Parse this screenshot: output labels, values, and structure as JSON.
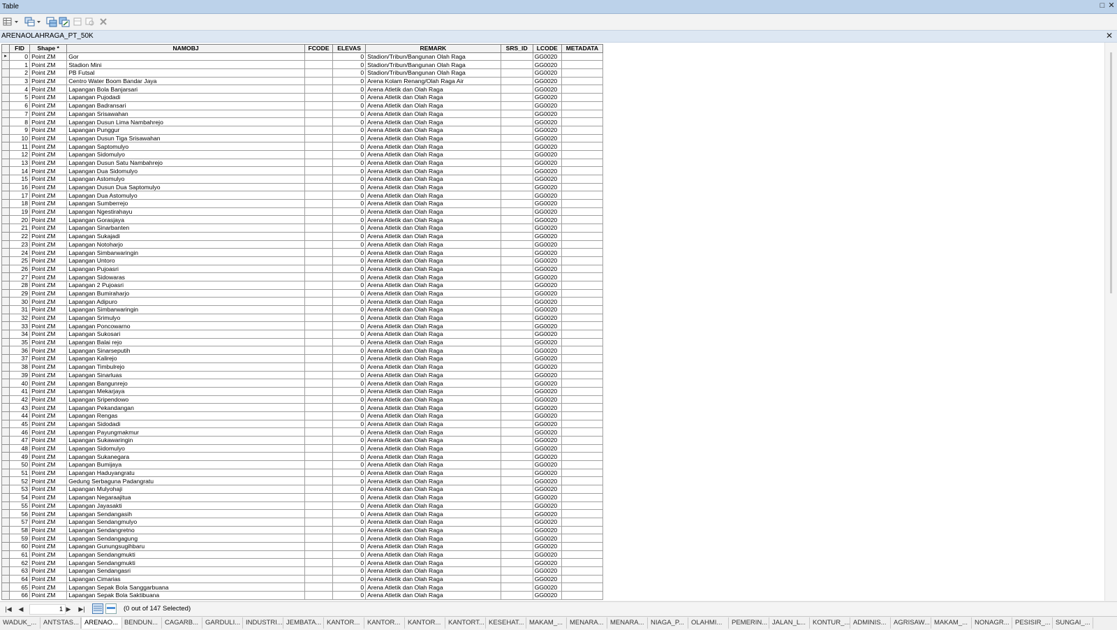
{
  "window": {
    "title": "Table"
  },
  "table_tab": {
    "name": "ARENAOLAHRAGA_PT_50K"
  },
  "columns": [
    "FID",
    "Shape *",
    "NAMOBJ",
    "FCODE",
    "ELEVAS",
    "REMARK",
    "SRS_ID",
    "LCODE",
    "METADATA"
  ],
  "row_common": {
    "shape": "Point ZM",
    "elevas": "0",
    "lcode": "GG0020"
  },
  "rows": [
    {
      "fid": "0",
      "namobj": "Gor",
      "remark": "Stadion/Tribun/Bangunan Olah Raga"
    },
    {
      "fid": "1",
      "namobj": "Stadion Mini",
      "remark": "Stadion/Tribun/Bangunan Olah Raga"
    },
    {
      "fid": "2",
      "namobj": "PB Futsal",
      "remark": "Stadion/Tribun/Bangunan Olah Raga"
    },
    {
      "fid": "3",
      "namobj": "Centro Water Boom Bandar Jaya",
      "remark": "Arena Kolam Renang/Olah Raga Air"
    },
    {
      "fid": "4",
      "namobj": "Lapangan Bola Banjarsari",
      "remark": "Arena Atletik dan Olah Raga"
    },
    {
      "fid": "5",
      "namobj": "Lapangan Pujodadi",
      "remark": "Arena Atletik dan Olah Raga"
    },
    {
      "fid": "6",
      "namobj": "Lapangan Badransari",
      "remark": "Arena Atletik dan Olah Raga"
    },
    {
      "fid": "7",
      "namobj": "Lapangan Srisawahan",
      "remark": "Arena Atletik dan Olah Raga"
    },
    {
      "fid": "8",
      "namobj": "Lapangan Dusun Lima Nambahrejo",
      "remark": "Arena Atletik dan Olah Raga"
    },
    {
      "fid": "9",
      "namobj": "Lapangan Punggur",
      "remark": "Arena Atletik dan Olah Raga"
    },
    {
      "fid": "10",
      "namobj": "Lapangan Dusun Tiga Srisawahan",
      "remark": "Arena Atletik dan Olah Raga"
    },
    {
      "fid": "11",
      "namobj": "Lapangan Saptomulyo",
      "remark": "Arena Atletik dan Olah Raga"
    },
    {
      "fid": "12",
      "namobj": "Lapangan Sidomulyo",
      "remark": "Arena Atletik dan Olah Raga"
    },
    {
      "fid": "13",
      "namobj": "Lapangan Dusun Satu Nambahrejo",
      "remark": "Arena Atletik dan Olah Raga"
    },
    {
      "fid": "14",
      "namobj": "Lapangan Dua Sidomulyo",
      "remark": "Arena Atletik dan Olah Raga"
    },
    {
      "fid": "15",
      "namobj": "Lapangan Astomulyo",
      "remark": "Arena Atletik dan Olah Raga"
    },
    {
      "fid": "16",
      "namobj": "Lapangan Dusun Dua Saptomulyo",
      "remark": "Arena Atletik dan Olah Raga"
    },
    {
      "fid": "17",
      "namobj": "Lapangan Dua Astomulyo",
      "remark": "Arena Atletik dan Olah Raga"
    },
    {
      "fid": "18",
      "namobj": "Lapangan Sumberrejo",
      "remark": "Arena Atletik dan Olah Raga"
    },
    {
      "fid": "19",
      "namobj": "Lapangan Ngestirahayu",
      "remark": "Arena Atletik dan Olah Raga"
    },
    {
      "fid": "20",
      "namobj": "Lapangan Gorasjaya",
      "remark": "Arena Atletik dan Olah Raga"
    },
    {
      "fid": "21",
      "namobj": "Lapangan Sinarbanten",
      "remark": "Arena Atletik dan Olah Raga"
    },
    {
      "fid": "22",
      "namobj": "Lapangan Sukajadi",
      "remark": "Arena Atletik dan Olah Raga"
    },
    {
      "fid": "23",
      "namobj": "Lapangan Notoharjo",
      "remark": "Arena Atletik dan Olah Raga"
    },
    {
      "fid": "24",
      "namobj": "Lapangan Simbarwaringin",
      "remark": "Arena Atletik dan Olah Raga"
    },
    {
      "fid": "25",
      "namobj": "Lapangan Untoro",
      "remark": "Arena Atletik dan Olah Raga"
    },
    {
      "fid": "26",
      "namobj": "Lapangan Pujoasri",
      "remark": "Arena Atletik dan Olah Raga"
    },
    {
      "fid": "27",
      "namobj": "Lapangan Sidowaras",
      "remark": "Arena Atletik dan Olah Raga"
    },
    {
      "fid": "28",
      "namobj": "Lapangan 2 Pujoasri",
      "remark": "Arena Atletik dan Olah Raga"
    },
    {
      "fid": "29",
      "namobj": "Lapangan Bumiraharjo",
      "remark": "Arena Atletik dan Olah Raga"
    },
    {
      "fid": "30",
      "namobj": "Lapangan Adipuro",
      "remark": "Arena Atletik dan Olah Raga"
    },
    {
      "fid": "31",
      "namobj": "Lapangan Simbarwaringin",
      "remark": "Arena Atletik dan Olah Raga"
    },
    {
      "fid": "32",
      "namobj": "Lapangan Srimulyo",
      "remark": "Arena Atletik dan Olah Raga"
    },
    {
      "fid": "33",
      "namobj": "Lapangan Poncowarno",
      "remark": "Arena Atletik dan Olah Raga"
    },
    {
      "fid": "34",
      "namobj": "Lapangan Sukosari",
      "remark": "Arena Atletik dan Olah Raga"
    },
    {
      "fid": "35",
      "namobj": "Lapangan Balai rejo",
      "remark": "Arena Atletik dan Olah Raga"
    },
    {
      "fid": "36",
      "namobj": "Lapangan Sinarseputih",
      "remark": "Arena Atletik dan Olah Raga"
    },
    {
      "fid": "37",
      "namobj": "Lapangan Kalirejo",
      "remark": "Arena Atletik dan Olah Raga"
    },
    {
      "fid": "38",
      "namobj": "Lapangan Timbulrejo",
      "remark": "Arena Atletik dan Olah Raga"
    },
    {
      "fid": "39",
      "namobj": "Lapangan Sinarluas",
      "remark": "Arena Atletik dan Olah Raga"
    },
    {
      "fid": "40",
      "namobj": "Lapangan Bangunrejo",
      "remark": "Arena Atletik dan Olah Raga"
    },
    {
      "fid": "41",
      "namobj": "Lapangan Mekarjaya",
      "remark": "Arena Atletik dan Olah Raga"
    },
    {
      "fid": "42",
      "namobj": "Lapangan Sripendowo",
      "remark": "Arena Atletik dan Olah Raga"
    },
    {
      "fid": "43",
      "namobj": "Lapangan Pekandangan",
      "remark": "Arena Atletik dan Olah Raga"
    },
    {
      "fid": "44",
      "namobj": "Lapangan Rengas",
      "remark": "Arena Atletik dan Olah Raga"
    },
    {
      "fid": "45",
      "namobj": "Lapangan Sidodadi",
      "remark": "Arena Atletik dan Olah Raga"
    },
    {
      "fid": "46",
      "namobj": "Lapangan Payungmakmur",
      "remark": "Arena Atletik dan Olah Raga"
    },
    {
      "fid": "47",
      "namobj": "Lapangan Sukawaringin",
      "remark": "Arena Atletik dan Olah Raga"
    },
    {
      "fid": "48",
      "namobj": "Lapangan Sidomulyo",
      "remark": "Arena Atletik dan Olah Raga"
    },
    {
      "fid": "49",
      "namobj": "Lapangan Sukanegara",
      "remark": "Arena Atletik dan Olah Raga"
    },
    {
      "fid": "50",
      "namobj": "Lapangan Bumijaya",
      "remark": "Arena Atletik dan Olah Raga"
    },
    {
      "fid": "51",
      "namobj": "Lapangan Haduyangratu",
      "remark": "Arena Atletik dan Olah Raga"
    },
    {
      "fid": "52",
      "namobj": "Gedung Serbaguna Padangratu",
      "remark": "Arena Atletik dan Olah Raga"
    },
    {
      "fid": "53",
      "namobj": "Lapangan Mulyohaji",
      "remark": "Arena Atletik dan Olah Raga"
    },
    {
      "fid": "54",
      "namobj": "Lapangan Negaraajitua",
      "remark": "Arena Atletik dan Olah Raga"
    },
    {
      "fid": "55",
      "namobj": "Lapangan Jayasakti",
      "remark": "Arena Atletik dan Olah Raga"
    },
    {
      "fid": "56",
      "namobj": "Lapangan Sendangasih",
      "remark": "Arena Atletik dan Olah Raga"
    },
    {
      "fid": "57",
      "namobj": "Lapangan Sendangmulyo",
      "remark": "Arena Atletik dan Olah Raga"
    },
    {
      "fid": "58",
      "namobj": "Lapangan Sendangretno",
      "remark": "Arena Atletik dan Olah Raga"
    },
    {
      "fid": "59",
      "namobj": "Lapangan Sendangagung",
      "remark": "Arena Atletik dan Olah Raga"
    },
    {
      "fid": "60",
      "namobj": "Lapangan Gunungsugihbaru",
      "remark": "Arena Atletik dan Olah Raga"
    },
    {
      "fid": "61",
      "namobj": "Lapangan Sendangmukti",
      "remark": "Arena Atletik dan Olah Raga"
    },
    {
      "fid": "62",
      "namobj": "Lapangan Sendangmukti",
      "remark": "Arena Atletik dan Olah Raga"
    },
    {
      "fid": "63",
      "namobj": "Lapangan Sendangasri",
      "remark": "Arena Atletik dan Olah Raga"
    },
    {
      "fid": "64",
      "namobj": "Lapangan Cimarias",
      "remark": "Arena Atletik dan Olah Raga"
    },
    {
      "fid": "65",
      "namobj": "Lapangan Sepak Bola Sanggarbuana",
      "remark": "Arena Atletik dan Olah Raga"
    },
    {
      "fid": "66",
      "namobj": "Lapangan Sepak Bola Saktibuana",
      "remark": "Arena Atletik dan Olah Raga"
    }
  ],
  "navigation": {
    "current_record": "1",
    "selection_text": "(0 out of 147 Selected)"
  },
  "layer_tabs": [
    "WADUK_...",
    "ANTSTAS...",
    "ARENAO...",
    "BENDUN...",
    "CAGARB...",
    "GARDULI...",
    "INDUSTRI...",
    "JEMBATA...",
    "KANTOR...",
    "KANTOR...",
    "KANTOR...",
    "KANTORT...",
    "KESEHAT...",
    "MAKAM_...",
    "MENARA...",
    "MENARA...",
    "NIAGA_P...",
    "OLAHMI...",
    "PEMERIN...",
    "JALAN_L...",
    "KONTUR_...",
    "ADMINIS...",
    "AGRISAW...",
    "MAKAM_...",
    "NONAGR...",
    "PESISIR_...",
    "SUNGAI_..."
  ],
  "active_layer_tab": 2,
  "icons": {
    "table-options": "table-options-icon",
    "related-tables": "related-tables-icon",
    "select-by-attributes": "select-by-attributes-icon",
    "switch-selection": "switch-selection-icon",
    "clear-selection": "clear-selection-icon",
    "zoom-to-selected": "zoom-to-selected-icon",
    "delete-selected": "delete-selected-icon"
  }
}
